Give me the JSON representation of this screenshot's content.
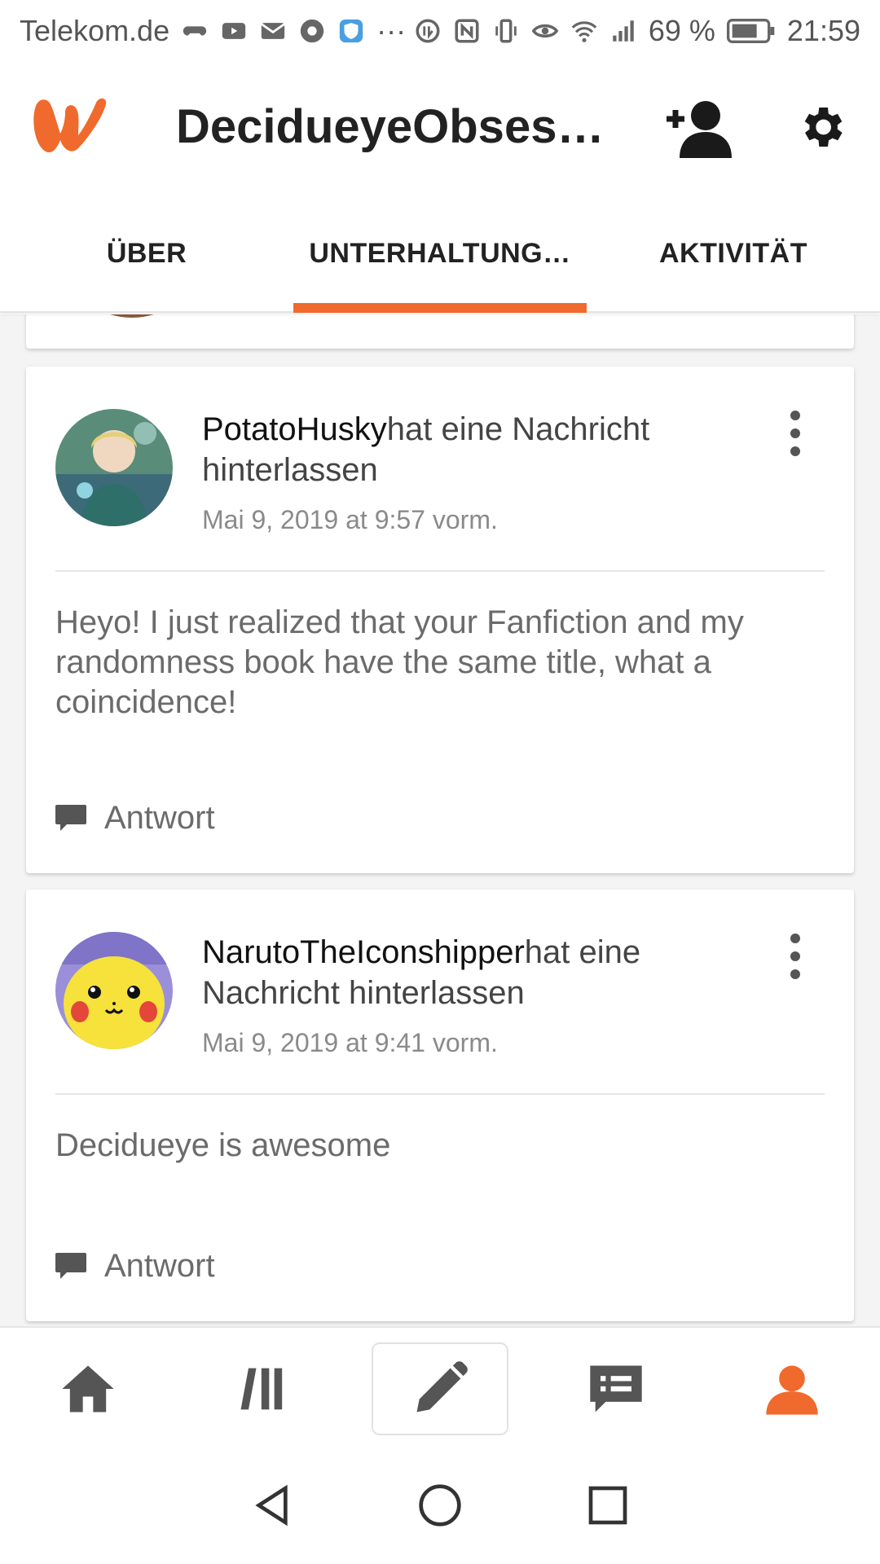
{
  "status_bar": {
    "carrier": "Telekom.de",
    "more": "···",
    "battery": "69 %",
    "time": "21:59"
  },
  "header": {
    "profile_name": "DecidueyeObsessi…",
    "logo_icon": "wattpad-logo",
    "follow_icon": "add-person-icon",
    "settings_icon": "gear-icon"
  },
  "tabs": [
    {
      "label": "ÜBER",
      "active": false
    },
    {
      "label": "UNTERHALTUNG…",
      "active": true
    },
    {
      "label": "AKTIVITÄT",
      "active": false
    }
  ],
  "messages": [
    {
      "author": "PotatoHusky",
      "action": "hat eine Nachricht hinterlassen",
      "timestamp": "Mai 9, 2019 at 9:57 vorm.",
      "text": "Heyo! I just realized that your Fanfiction and my randomness book have the same title, what a coincidence!",
      "reply_label": "Antwort"
    },
    {
      "author": "NarutoTheIconshipper",
      "action": "hat eine Nachricht hinterlassen",
      "timestamp": "Mai 9, 2019 at 9:41 vorm.",
      "text": "Decidueye is awesome",
      "reply_label": "Antwort"
    }
  ],
  "bottom_nav": [
    {
      "name": "home-icon",
      "active": false
    },
    {
      "name": "library-icon",
      "active": false
    },
    {
      "name": "write-icon",
      "active": false
    },
    {
      "name": "messages-icon",
      "active": false
    },
    {
      "name": "profile-icon",
      "active": true
    }
  ],
  "colors": {
    "accent": "#f06a2d",
    "icon_dark": "#555555"
  }
}
